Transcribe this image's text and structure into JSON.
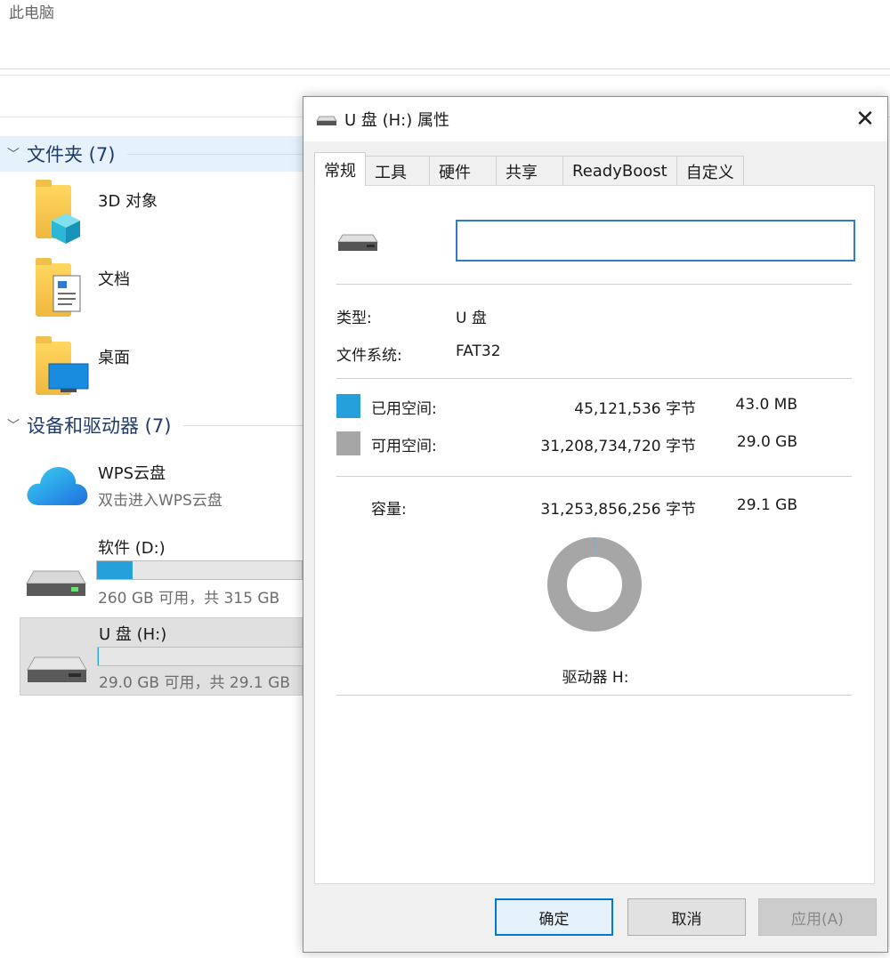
{
  "explorer": {
    "title": "此电脑",
    "groups": {
      "folders": {
        "label": "文件夹 (7)"
      },
      "devices": {
        "label": "设备和驱动器 (7)"
      }
    },
    "folders": [
      {
        "label": "3D 对象",
        "icon": "cube-folder-icon"
      },
      {
        "label": "文档",
        "icon": "document-folder-icon"
      },
      {
        "label": "桌面",
        "icon": "desktop-folder-icon"
      }
    ],
    "devices": [
      {
        "label": "WPS云盘",
        "subtitle": "双击进入WPS云盘",
        "icon": "cloud-icon"
      },
      {
        "label": "软件 (D:)",
        "subtitle": "260 GB 可用，共 315 GB",
        "used_fraction": 0.175,
        "icon": "drive-icon"
      },
      {
        "label": "U 盘 (H:)",
        "subtitle": "29.0 GB 可用，共 29.1 GB",
        "used_fraction": 0.0015,
        "icon": "usb-drive-icon"
      }
    ]
  },
  "dialog": {
    "title": "U 盘 (H:) 属性",
    "close_label": "✕",
    "tabs": [
      {
        "label": "常规",
        "active": true
      },
      {
        "label": "工具"
      },
      {
        "label": "硬件"
      },
      {
        "label": "共享"
      },
      {
        "label": "ReadyBoost"
      },
      {
        "label": "自定义"
      }
    ],
    "general": {
      "name_value": "",
      "type_label": "类型:",
      "type_value": "U 盘",
      "fs_label": "文件系统:",
      "fs_value": "FAT32",
      "used": {
        "label": "已用空间:",
        "bytes": "45,121,536 字节",
        "size": "43.0 MB",
        "color": "#26a0da"
      },
      "free": {
        "label": "可用空间:",
        "bytes": "31,208,734,720 字节",
        "size": "29.0 GB",
        "color": "#a6a6a6"
      },
      "capacity": {
        "label": "容量:",
        "bytes": "31,253,856,256 字节",
        "size": "29.1 GB"
      },
      "drive_label": "驱动器 H:"
    },
    "buttons": {
      "ok": "确定",
      "cancel": "取消",
      "apply": "应用(A)"
    }
  },
  "chart_data": {
    "type": "pie",
    "categories": [
      "已用空间",
      "可用空间"
    ],
    "values": [
      45121536,
      31208734720
    ],
    "colors": [
      "#26a0da",
      "#a6a6a6"
    ]
  }
}
